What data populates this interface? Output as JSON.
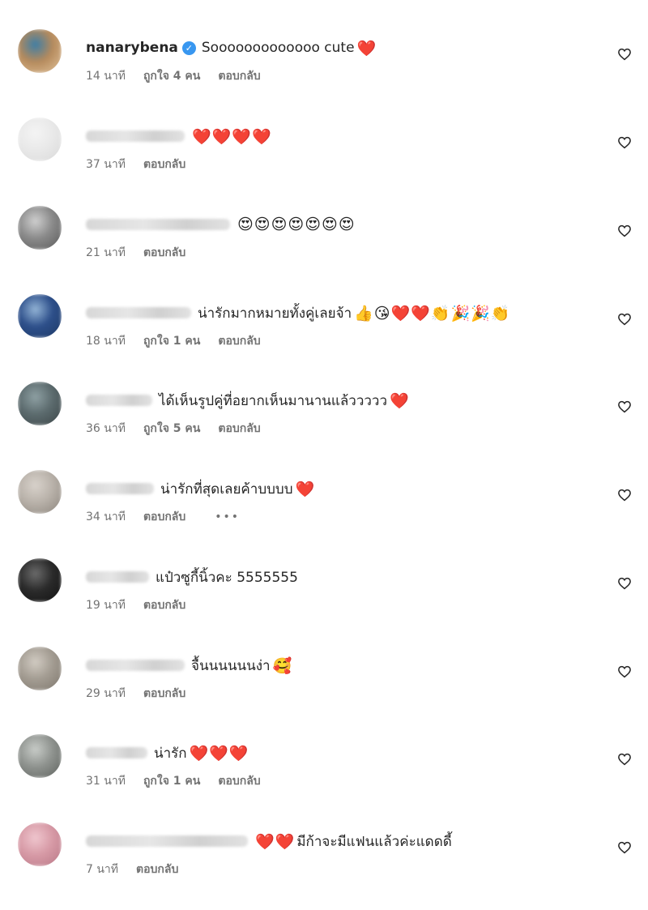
{
  "comments": [
    {
      "user": "nanarybena",
      "verified": true,
      "text": "Sooooooooooooo cute",
      "emoji": "❤️",
      "time": "14 นาที",
      "likes": "ถูกใจ 4 คน",
      "reply": "ตอบกลับ",
      "avatar_colors": [
        "#b58a5c",
        "#3e7ea6",
        "#e2c49c"
      ]
    },
    {
      "user": "",
      "verified": false,
      "text": "",
      "emoji": "❤️❤️❤️❤️",
      "time": "37 นาที",
      "likes": "",
      "reply": "ตอบกลับ",
      "avatar_colors": [
        "#e9e9e9",
        "#f4f4f4",
        "#d9d9d9"
      ]
    },
    {
      "user": "",
      "verified": false,
      "text": "",
      "emoji": "😍😍😍😍😍😍😍",
      "time": "21 นาที",
      "likes": "",
      "reply": "ตอบกลับ",
      "avatar_colors": [
        "#8a8a8a",
        "#cfcfcf",
        "#5a5a5a"
      ]
    },
    {
      "user": "",
      "verified": false,
      "text": "น่ารักมากหมายทั้งคู่เลยจ้า",
      "emoji": "👍😘❤️❤️👏🎉🎉👏",
      "time": "18 นาที",
      "likes": "ถูกใจ 1 คน",
      "reply": "ตอบกลับ",
      "avatar_colors": [
        "#2d4f8a",
        "#93b4d6",
        "#1e3a66"
      ]
    },
    {
      "user": "",
      "verified": false,
      "text": "ได้เห็นรูปคู่ที่อยากเห็นมานานแล้ววววว",
      "emoji": "❤️",
      "time": "36 นาที",
      "likes": "ถูกใจ 5 คน",
      "reply": "ตอบกลับ",
      "avatar_colors": [
        "#5c6b6e",
        "#8ea0a3",
        "#3b4547"
      ]
    },
    {
      "user": "",
      "verified": false,
      "text": "น่ารักที่สุดเลยค้าบบบบ",
      "emoji": "❤️",
      "time": "34 นาที",
      "likes": "",
      "reply": "ตอบกลับ",
      "more": "•••",
      "avatar_colors": [
        "#b9b2aa",
        "#d8d2cb",
        "#8c857d"
      ]
    },
    {
      "user": "",
      "verified": false,
      "text": "แป๋วซูกี้นิ้วคะ 5555555",
      "emoji": "",
      "time": "19 นาที",
      "likes": "",
      "reply": "ตอบกลับ",
      "avatar_colors": [
        "#2a2a2a",
        "#6b6b6b",
        "#121212"
      ]
    },
    {
      "user": "",
      "verified": false,
      "text": "จื้นนนนนนง่า",
      "emoji": "🥰",
      "time": "29 นาที",
      "likes": "",
      "reply": "ตอบกลับ",
      "avatar_colors": [
        "#a39c92",
        "#d1cbc2",
        "#7e776d"
      ]
    },
    {
      "user": "",
      "verified": false,
      "text": "น่ารัก",
      "emoji": "❤️❤️❤️",
      "time": "31 นาที",
      "likes": "ถูกใจ 1 คน",
      "reply": "ตอบกลับ",
      "avatar_colors": [
        "#8f938f",
        "#c8ccc8",
        "#5e625e"
      ]
    },
    {
      "user": "",
      "verified": false,
      "text": "มีก้าจะมีแฟนแล้วค่ะแดดดี้",
      "emoji": "❤️❤️",
      "emoji_first": true,
      "time": "7 นาที",
      "likes": "",
      "reply": "ตอบกลับ",
      "avatar_colors": [
        "#d79aa6",
        "#efc6ce",
        "#b87786"
      ]
    }
  ]
}
